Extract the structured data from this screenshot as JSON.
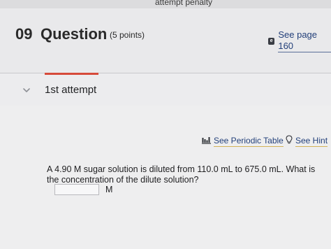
{
  "top": {
    "penalty_text": "attempt penalty"
  },
  "header": {
    "number": "09",
    "title": "Question",
    "points": "(5 points)",
    "see_page_label": "See page 160",
    "ebook_icon_letter": "e"
  },
  "attempt": {
    "label": "1st attempt",
    "accent_color": "#d64a3a"
  },
  "tools": {
    "periodic_table": "See Periodic Table",
    "hint": "See Hint"
  },
  "question": {
    "text": "A 4.90 M sugar solution is diluted from 110.0 mL to 675.0 mL. What is the concentration of the dilute solution?",
    "answer_value": "",
    "unit": "M"
  },
  "colors": {
    "link": "#23407a",
    "link_underline": "#d3b35a"
  }
}
